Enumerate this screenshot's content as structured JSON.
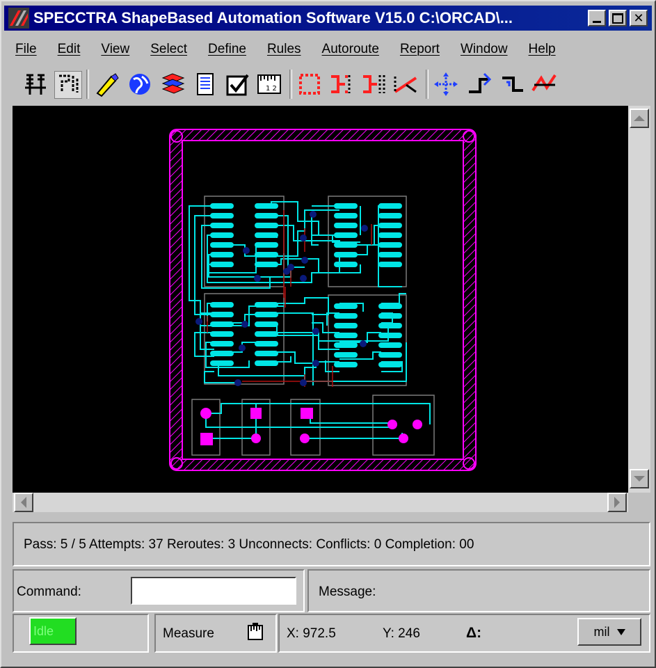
{
  "window": {
    "title": "SPECCTRA ShapeBased Automation Software V15.0 C:\\ORCAD\\...",
    "caption_buttons": [
      "minimize",
      "maximize",
      "close"
    ]
  },
  "menu": [
    "File",
    "Edit",
    "View",
    "Select",
    "Define",
    "Rules",
    "Autoroute",
    "Report",
    "Window",
    "Help"
  ],
  "toolbar": {
    "icons": [
      "route-mode-icon",
      "edit-route-icon",
      "highlight-pen-icon",
      "globe-icon",
      "layers-icon",
      "document-icon",
      "checkbox-icon",
      "ruler-icon",
      "place-component-icon",
      "split-icon",
      "split-alt-icon",
      "diagonal-route-icon",
      "move-icon",
      "push-route-icon",
      "bend-icon",
      "miter-icon"
    ]
  },
  "status": {
    "text": "Pass:  5 / 5  Attempts: 37  Reroutes: 3 Unconnects:  Conflicts:  0  Completion: 00"
  },
  "command": {
    "label": "Command:",
    "value": ""
  },
  "message": {
    "label": "Message:"
  },
  "bottom": {
    "state": "Idle",
    "mode": "Measure",
    "x": "X: 972.5",
    "y": "Y: 246",
    "delta": "Δ:",
    "units": "mil"
  },
  "colors": {
    "board_outline": "#ff00ff",
    "traces": "#00e5e5",
    "vias": "#0a1a7a",
    "canvas_bg": "#000000",
    "idle_green": "#22dd22"
  }
}
